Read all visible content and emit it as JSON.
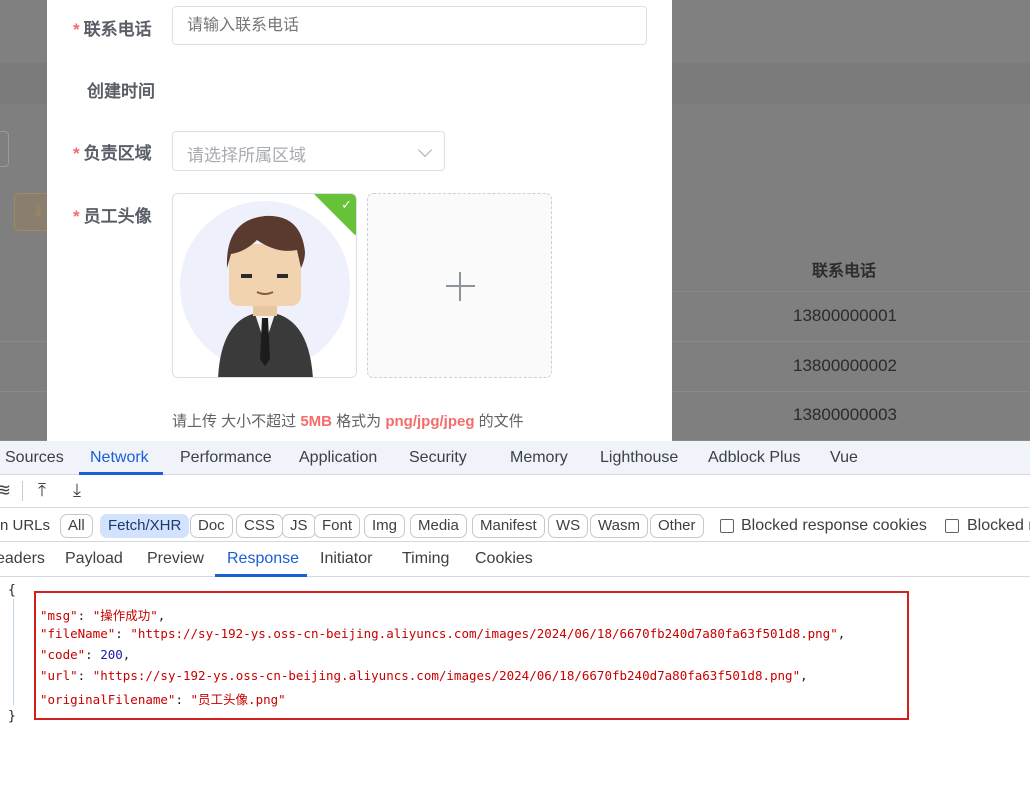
{
  "form": {
    "phone_label": "联系电话",
    "phone_placeholder": "请输入联系电话",
    "created_label": "创建时间",
    "region_label": "负责区域",
    "region_placeholder": "请选择所属区域",
    "avatar_label": "员工头像",
    "required_mark": "*",
    "upload_tip": {
      "prefix": "请上传 大小不超过 ",
      "size": "5MB",
      "middle": " 格式为 ",
      "formats": "png/jpg/jpeg",
      "suffix": " 的文件"
    }
  },
  "background_table": {
    "column_header": "联系电话",
    "rows": [
      "13800000001",
      "13800000002",
      "13800000003"
    ]
  },
  "devtools": {
    "tabs": [
      "Sources",
      "Network",
      "Performance",
      "Application",
      "Security",
      "Memory",
      "Lighthouse",
      "Adblock Plus",
      "Vue"
    ],
    "active_tab": "Network",
    "filter_prefix": "n URLs",
    "filter_chips": [
      "All",
      "Fetch/XHR",
      "Doc",
      "CSS",
      "JS",
      "Font",
      "Img",
      "Media",
      "Manifest",
      "WS",
      "Wasm",
      "Other"
    ],
    "active_chip": "Fetch/XHR",
    "checkboxes": [
      "Blocked response cookies",
      "Blocked r"
    ],
    "subtabs": [
      "eaders",
      "Payload",
      "Preview",
      "Response",
      "Initiator",
      "Timing",
      "Cookies"
    ],
    "active_subtab": "Response",
    "response": {
      "open_brace": "{",
      "close_brace": "}",
      "msg_key": "\"msg\"",
      "msg_value": "\"操作成功\"",
      "fileName_key": "\"fileName\"",
      "fileName_value": "\"https://sy-192-ys.oss-cn-beijing.aliyuncs.com/images/2024/06/18/6670fb240d7a80fa63f501d8.png\"",
      "code_key": "\"code\"",
      "code_value": "200",
      "url_key": "\"url\"",
      "url_value": "\"https://sy-192-ys.oss-cn-beijing.aliyuncs.com/images/2024/06/18/6670fb240d7a80fa63f501d8.png\"",
      "originalFilename_key": "\"originalFilename\"",
      "originalFilename_value": "\"员工头像.png\""
    }
  },
  "colors": {
    "accent": "#1a5fd6",
    "required": "#f56c6c",
    "success": "#67c23a",
    "highlight_border": "#d21f1f"
  },
  "icons": [
    "chevron-down-icon",
    "check-icon",
    "plus-icon",
    "wifi-settings-icon",
    "upload-icon",
    "download-icon"
  ]
}
